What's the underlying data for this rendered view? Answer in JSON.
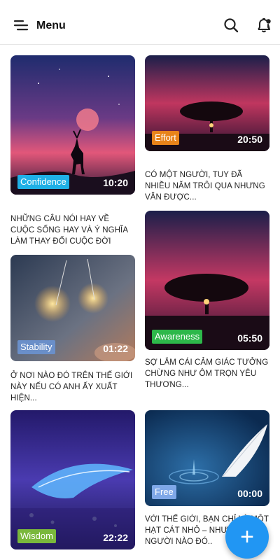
{
  "header": {
    "title": "Menu",
    "icons": [
      "menu-icon",
      "search-icon",
      "notification-bell-icon"
    ]
  },
  "cards": [
    {
      "badge": "Confidence",
      "badge_color": "#1fb0e6",
      "duration": "10:20",
      "caption": "NHỮNG CÂU NÓI HAY VỀ CUỘC SỐNG HAY VÀ Ý NGHĨA LÀM THAY ĐỔI CUỘC ĐỜI"
    },
    {
      "badge": "Effort",
      "badge_color": "#e8831a",
      "duration": "20:50",
      "caption": "CÓ MỘT NGƯỜI, TUY ĐÃ NHIỀU NĂM TRÔI QUA NHƯNG VẪN ĐƯỢC..."
    },
    {
      "badge": "Stability",
      "badge_color": "#6a8fc9",
      "duration": "01:22",
      "caption": "Ở NƠI NÀO ĐÓ TRÊN THẾ GIỚI NÀY NẾU CÓ ANH ẤY XUẤT HIỆN..."
    },
    {
      "badge": "Awareness",
      "badge_color": "#2db84a",
      "duration": "05:50",
      "caption": "SỢ LẮM CÁI CẢM GIÁC TƯỞNG CHỪNG NHƯ ÔM TRỌN YÊU THƯƠNG..."
    },
    {
      "badge": "Wisdom",
      "badge_color": "#7ab83c",
      "duration": "22:22",
      "caption": ""
    },
    {
      "badge": "Free",
      "badge_color": "#7fa8e8",
      "duration": "00:00",
      "caption": "VỚI THẾ GIỚI, BẠN CHỈ LÀ MỘT HẠT CÁT NHỎ – NHƯNG VỚI NGƯỜI NÀO ĐÓ.."
    }
  ],
  "fab": {
    "icon": "plus-icon",
    "label": "+"
  },
  "colors": {
    "accent": "#2196f3"
  }
}
